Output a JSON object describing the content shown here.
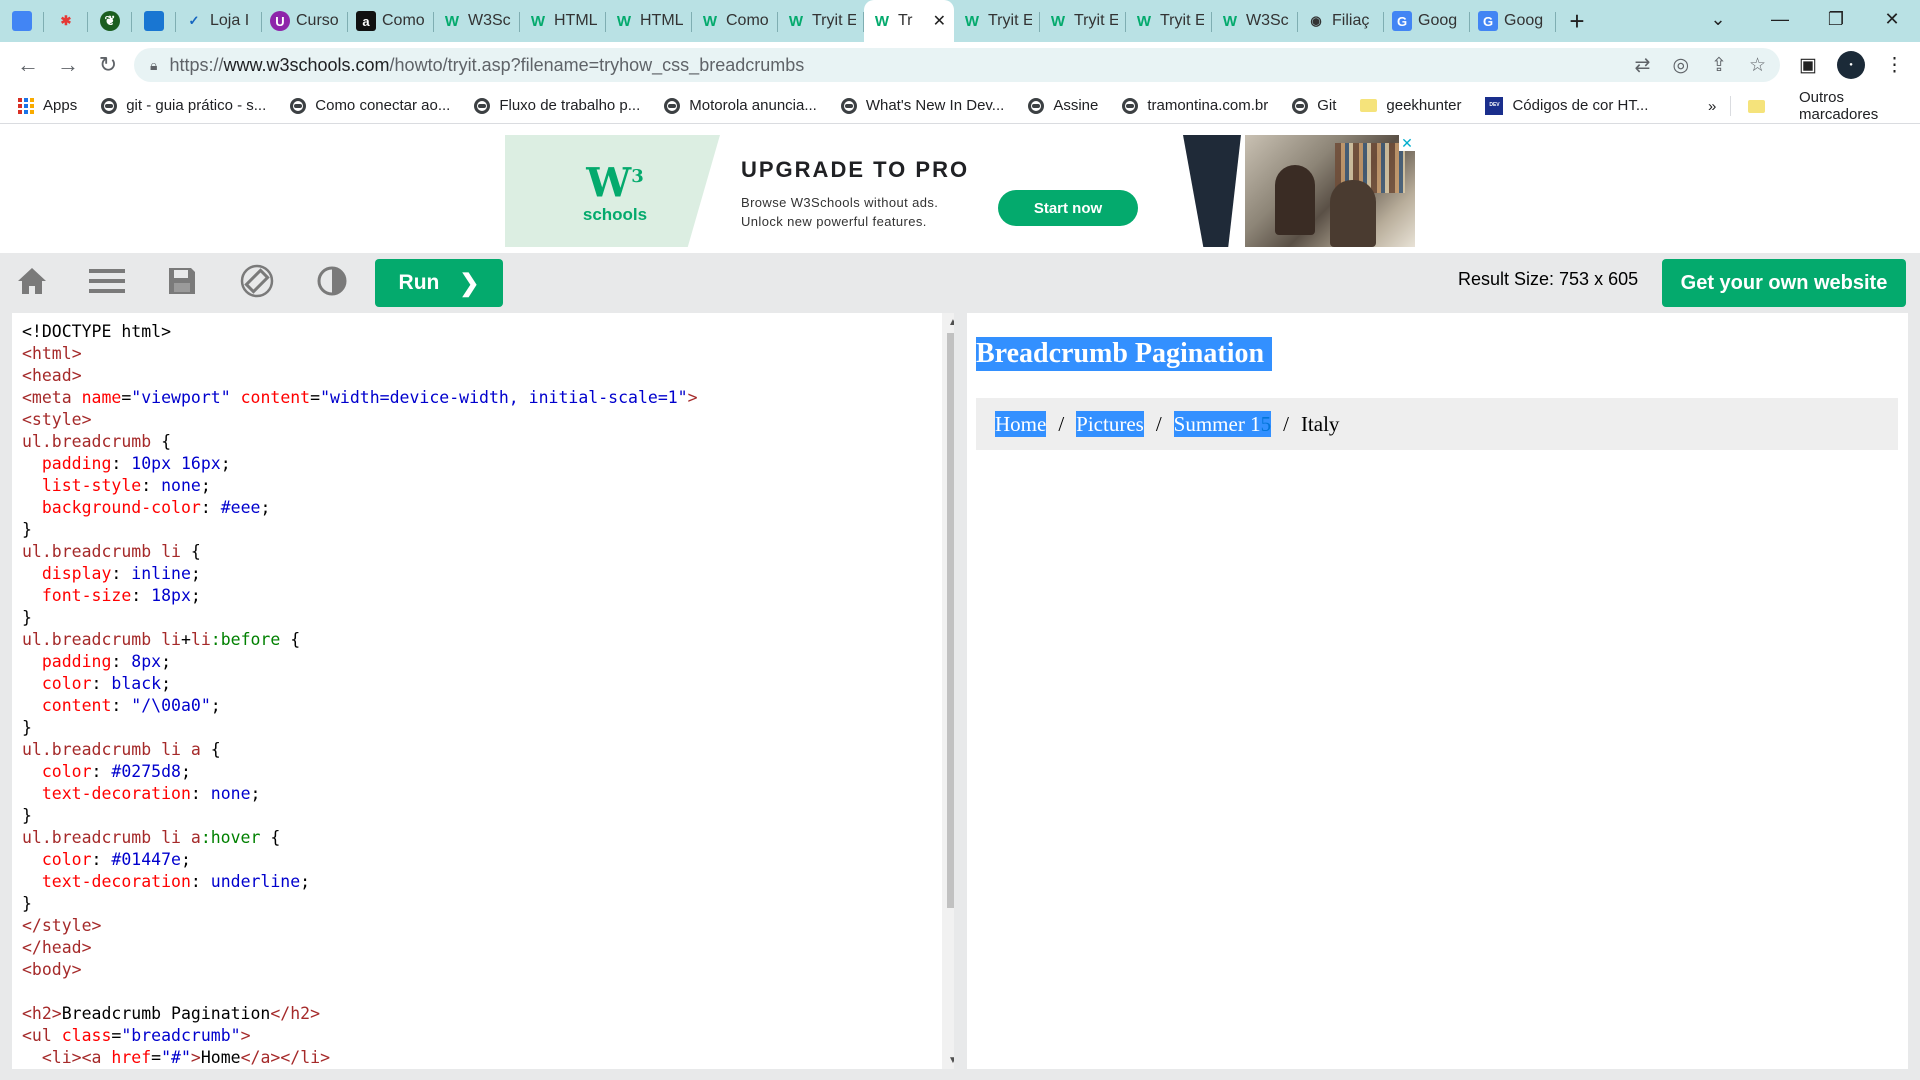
{
  "browser": {
    "tabs": [
      {
        "title": "",
        "icon": "pinned-app-icon",
        "pinned": true,
        "color": "#4285f4"
      },
      {
        "title": "",
        "icon": "asterisk-app-icon",
        "pinned": true,
        "color": "#e53935"
      },
      {
        "title": "",
        "icon": "leaf-app-icon",
        "pinned": true,
        "color": "#1b5e20"
      },
      {
        "title": "",
        "icon": "blue-doc-icon",
        "pinned": true,
        "color": "#1976d2"
      },
      {
        "title": "Loja I",
        "icon": "swoosh-icon",
        "color": "#1565c0"
      },
      {
        "title": "Curso",
        "icon": "u-icon",
        "color": "#8e24aa"
      },
      {
        "title": "Como",
        "icon": "a-icon",
        "color": "#111111"
      },
      {
        "title": "W3Sc",
        "icon": "w3-icon",
        "color": "#04aa6d"
      },
      {
        "title": "HTML",
        "icon": "w3-icon",
        "color": "#04aa6d"
      },
      {
        "title": "HTML",
        "icon": "w3-icon",
        "color": "#04aa6d"
      },
      {
        "title": "Como",
        "icon": "w3-icon",
        "color": "#04aa6d"
      },
      {
        "title": "Tryit E",
        "icon": "w3-icon",
        "color": "#04aa6d"
      },
      {
        "title": "Tr",
        "icon": "w3-icon",
        "color": "#04aa6d",
        "active": true
      },
      {
        "title": "Tryit E",
        "icon": "w3-icon",
        "color": "#04aa6d"
      },
      {
        "title": "Tryit E",
        "icon": "w3-icon",
        "color": "#04aa6d"
      },
      {
        "title": "Tryit E",
        "icon": "w3-icon",
        "color": "#04aa6d"
      },
      {
        "title": "W3Sc",
        "icon": "w3-icon",
        "color": "#04aa6d"
      },
      {
        "title": "Filiaç",
        "icon": "globe-icon",
        "color": "#333333"
      },
      {
        "title": "Goog",
        "icon": "google-translate-icon",
        "color": "#4285f4"
      },
      {
        "title": "Goog",
        "icon": "google-translate-icon",
        "color": "#4285f4"
      }
    ],
    "new_tab": "+",
    "url_prefix": "https://",
    "url_host": "www.w3schools.com",
    "url_path": "/howto/tryit.asp?filename=tryhow_css_breadcrumbs",
    "bookmarks": [
      {
        "label": "Apps",
        "icon": "apps-grid-icon"
      },
      {
        "label": "git - guia prático - s...",
        "icon": "globe-icon"
      },
      {
        "label": "Como conectar ao...",
        "icon": "globe-icon"
      },
      {
        "label": "Fluxo de trabalho p...",
        "icon": "globe-icon"
      },
      {
        "label": "Motorola anuncia...",
        "icon": "globe-icon"
      },
      {
        "label": "What's New In Dev...",
        "icon": "globe-icon"
      },
      {
        "label": "Assine",
        "icon": "globe-icon"
      },
      {
        "label": "tramontina.com.br",
        "icon": "globe-icon"
      },
      {
        "label": "Git",
        "icon": "globe-icon"
      },
      {
        "label": "geekhunter",
        "icon": "folder-icon"
      },
      {
        "label": "Códigos de cor HT...",
        "icon": "devtools-icon"
      }
    ],
    "bookmarks_more": "»",
    "other_bookmarks": "Outros marcadores"
  },
  "ad": {
    "logo_big": "W",
    "logo_sup": "3",
    "logo_small": "schools",
    "headline": "UPGRADE TO PRO",
    "line1": "Browse W3Schools without ads.",
    "line2": "Unlock new powerful features.",
    "cta": "Start now",
    "close": "✕"
  },
  "tryit": {
    "run_label": "Run",
    "run_chevron": "❯",
    "result_size": "Result Size: 753 x 605",
    "get_website": "Get your own website"
  },
  "code_lines": [
    [
      [
        "t-txt",
        "<!DOCTYPE html>"
      ]
    ],
    [
      [
        "t-tag",
        "<"
      ],
      [
        "t-tag",
        "html"
      ],
      [
        "t-tag",
        ">"
      ]
    ],
    [
      [
        "t-tag",
        "<"
      ],
      [
        "t-tag",
        "head"
      ],
      [
        "t-tag",
        ">"
      ]
    ],
    [
      [
        "t-tag",
        "<meta"
      ],
      [
        "t-txt",
        " "
      ],
      [
        "t-attr",
        "name"
      ],
      [
        "t-txt",
        "="
      ],
      [
        "t-str",
        "\"viewport\""
      ],
      [
        "t-txt",
        " "
      ],
      [
        "t-attr",
        "content"
      ],
      [
        "t-txt",
        "="
      ],
      [
        "t-str",
        "\"width=device-width, initial-scale=1\""
      ],
      [
        "t-tag",
        ">"
      ]
    ],
    [
      [
        "t-tag",
        "<style>"
      ]
    ],
    [
      [
        "t-sel",
        "ul.breadcrumb "
      ],
      [
        "t-txt",
        "{"
      ]
    ],
    [
      [
        "t-txt",
        "  "
      ],
      [
        "t-prop",
        "padding"
      ],
      [
        "t-txt",
        ": "
      ],
      [
        "t-val",
        "10px 16px"
      ],
      [
        "t-txt",
        ";"
      ]
    ],
    [
      [
        "t-txt",
        "  "
      ],
      [
        "t-prop",
        "list-style"
      ],
      [
        "t-txt",
        ": "
      ],
      [
        "t-val",
        "none"
      ],
      [
        "t-txt",
        ";"
      ]
    ],
    [
      [
        "t-txt",
        "  "
      ],
      [
        "t-prop",
        "background-color"
      ],
      [
        "t-txt",
        ": "
      ],
      [
        "t-val",
        "#eee"
      ],
      [
        "t-txt",
        ";"
      ]
    ],
    [
      [
        "t-txt",
        "}"
      ]
    ],
    [
      [
        "t-sel",
        "ul.breadcrumb li "
      ],
      [
        "t-txt",
        "{"
      ]
    ],
    [
      [
        "t-txt",
        "  "
      ],
      [
        "t-prop",
        "display"
      ],
      [
        "t-txt",
        ": "
      ],
      [
        "t-val",
        "inline"
      ],
      [
        "t-txt",
        ";"
      ]
    ],
    [
      [
        "t-txt",
        "  "
      ],
      [
        "t-prop",
        "font-size"
      ],
      [
        "t-txt",
        ": "
      ],
      [
        "t-val",
        "18px"
      ],
      [
        "t-txt",
        ";"
      ]
    ],
    [
      [
        "t-txt",
        "}"
      ]
    ],
    [
      [
        "t-sel",
        "ul.breadcrumb li"
      ],
      [
        "t-txt",
        "+"
      ],
      [
        "t-sel",
        "li"
      ],
      [
        "t-pc",
        ":before "
      ],
      [
        "t-txt",
        "{"
      ]
    ],
    [
      [
        "t-txt",
        "  "
      ],
      [
        "t-prop",
        "padding"
      ],
      [
        "t-txt",
        ": "
      ],
      [
        "t-val",
        "8px"
      ],
      [
        "t-txt",
        ";"
      ]
    ],
    [
      [
        "t-txt",
        "  "
      ],
      [
        "t-prop",
        "color"
      ],
      [
        "t-txt",
        ": "
      ],
      [
        "t-val",
        "black"
      ],
      [
        "t-txt",
        ";"
      ]
    ],
    [
      [
        "t-txt",
        "  "
      ],
      [
        "t-prop",
        "content"
      ],
      [
        "t-txt",
        ": "
      ],
      [
        "t-val",
        "\"/\\00a0\""
      ],
      [
        "t-txt",
        ";"
      ]
    ],
    [
      [
        "t-txt",
        "}"
      ]
    ],
    [
      [
        "t-sel",
        "ul.breadcrumb li a "
      ],
      [
        "t-txt",
        "{"
      ]
    ],
    [
      [
        "t-txt",
        "  "
      ],
      [
        "t-prop",
        "color"
      ],
      [
        "t-txt",
        ": "
      ],
      [
        "t-val",
        "#0275d8"
      ],
      [
        "t-txt",
        ";"
      ]
    ],
    [
      [
        "t-txt",
        "  "
      ],
      [
        "t-prop",
        "text-decoration"
      ],
      [
        "t-txt",
        ": "
      ],
      [
        "t-val",
        "none"
      ],
      [
        "t-txt",
        ";"
      ]
    ],
    [
      [
        "t-txt",
        "}"
      ]
    ],
    [
      [
        "t-sel",
        "ul.breadcrumb li a"
      ],
      [
        "t-pc",
        ":hover "
      ],
      [
        "t-txt",
        "{"
      ]
    ],
    [
      [
        "t-txt",
        "  "
      ],
      [
        "t-prop",
        "color"
      ],
      [
        "t-txt",
        ": "
      ],
      [
        "t-val",
        "#01447e"
      ],
      [
        "t-txt",
        ";"
      ]
    ],
    [
      [
        "t-txt",
        "  "
      ],
      [
        "t-prop",
        "text-decoration"
      ],
      [
        "t-txt",
        ": "
      ],
      [
        "t-val",
        "underline"
      ],
      [
        "t-txt",
        ";"
      ]
    ],
    [
      [
        "t-txt",
        "}"
      ]
    ],
    [
      [
        "t-tag",
        "</style>"
      ]
    ],
    [
      [
        "t-tag",
        "</head>"
      ]
    ],
    [
      [
        "t-tag",
        "<body>"
      ]
    ],
    [
      [
        "t-txt",
        ""
      ]
    ],
    [
      [
        "t-tag",
        "<h2>"
      ],
      [
        "t-txt",
        "Breadcrumb Pagination"
      ],
      [
        "t-tag",
        "</h2>"
      ]
    ],
    [
      [
        "t-tag",
        "<ul"
      ],
      [
        "t-txt",
        " "
      ],
      [
        "t-attr",
        "class"
      ],
      [
        "t-txt",
        "="
      ],
      [
        "t-str",
        "\"breadcrumb\""
      ],
      [
        "t-tag",
        ">"
      ]
    ],
    [
      [
        "t-txt",
        "  "
      ],
      [
        "t-tag",
        "<li><a"
      ],
      [
        "t-txt",
        " "
      ],
      [
        "t-attr",
        "href"
      ],
      [
        "t-txt",
        "="
      ],
      [
        "t-str",
        "\"#\""
      ],
      [
        "t-tag",
        ">"
      ],
      [
        "t-txt",
        "Home"
      ],
      [
        "t-tag",
        "</a></li>"
      ]
    ]
  ],
  "result": {
    "title": "Breadcrumb Pagination",
    "crumbs": [
      {
        "label": "Home",
        "selected": "Home",
        "rest": ""
      },
      {
        "label": "Pictures",
        "selected": "Pictures",
        "rest": ""
      },
      {
        "label": "Summer 15",
        "selected": "Summer 1",
        "rest": "5"
      }
    ],
    "separator": "/",
    "current": "Italy"
  },
  "colors": {
    "accent_green": "#04aa6d",
    "selection_blue": "#3390ff",
    "link_blue": "#0275d8",
    "tab_strip": "#b9e1e4"
  }
}
